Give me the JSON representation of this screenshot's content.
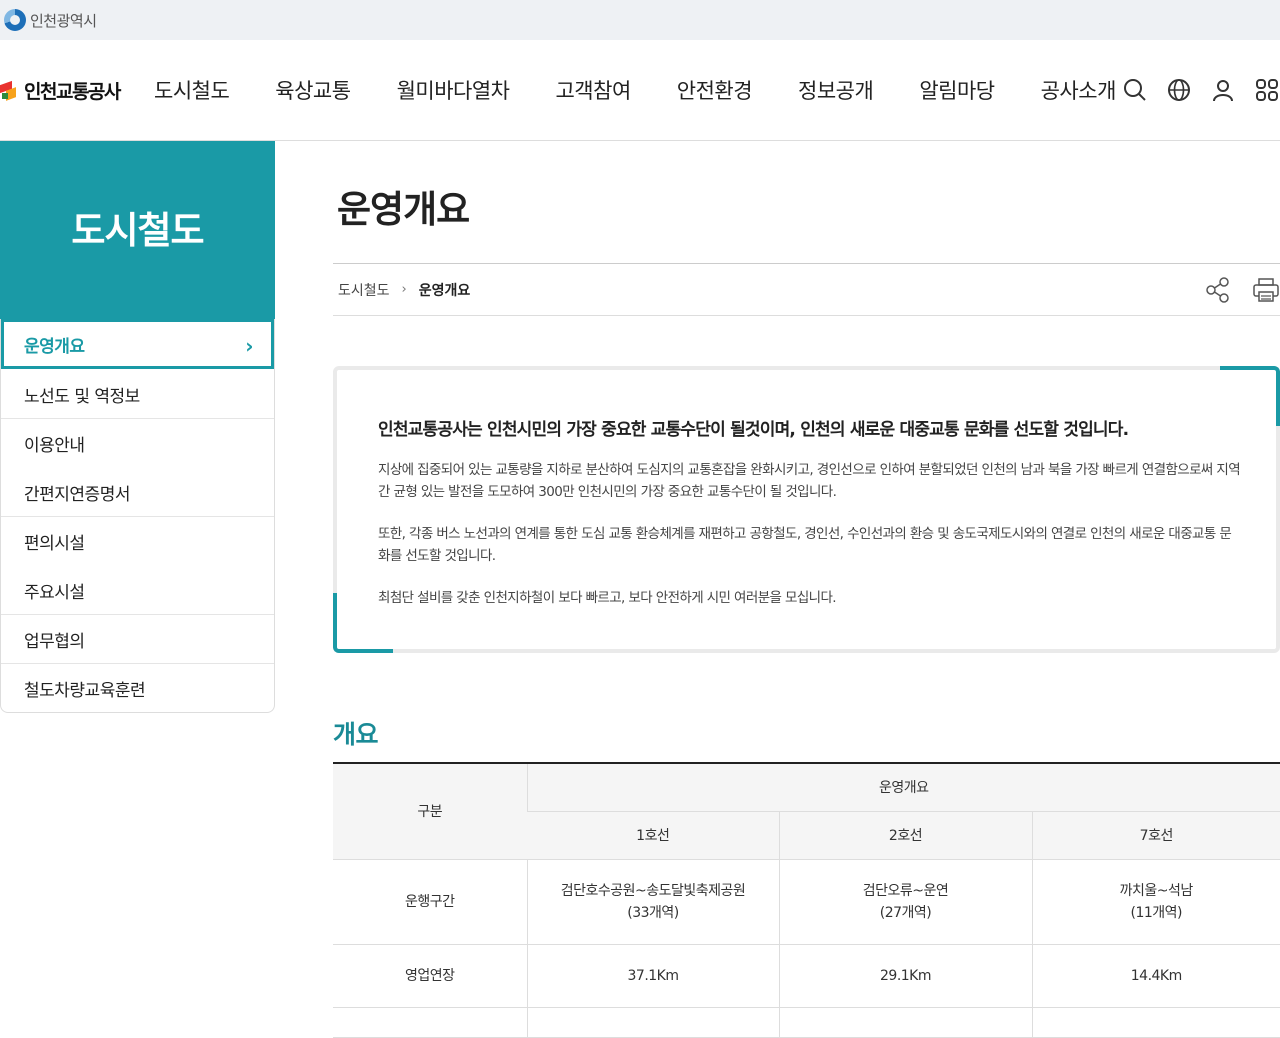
{
  "topbar": {
    "city_name": "인천광역시"
  },
  "header": {
    "brand": "인천교통공사",
    "menu": [
      "도시철도",
      "육상교통",
      "월미바다열차",
      "고객참여",
      "안전환경",
      "정보공개",
      "알림마당",
      "공사소개"
    ],
    "icons": [
      "search-icon",
      "globe-icon",
      "user-icon",
      "sitemap-icon"
    ]
  },
  "sidebar": {
    "title": "도시철도",
    "items": [
      {
        "label": "운영개요",
        "active": true
      },
      {
        "label": "노선도 및 역정보"
      },
      {
        "label": "이용안내"
      },
      {
        "label": "간편지연증명서"
      },
      {
        "label": "편의시설"
      },
      {
        "label": "주요시설"
      },
      {
        "label": "업무협의"
      },
      {
        "label": "철도차량교육훈련"
      }
    ]
  },
  "main": {
    "page_title": "운영개요",
    "breadcrumb": {
      "parent": "도시철도",
      "current": "운영개요"
    },
    "intro": {
      "heading": "인천교통공사는 인천시민의 가장 중요한 교통수단이 될것이며, 인천의 새로운 대중교통 문화를 선도할 것입니다.",
      "p1": "지상에 집중되어 있는 교통량을 지하로 분산하여 도심지의 교통혼잡을 완화시키고, 경인선으로 인하여 분할되었던 인천의 남과 북을 가장 빠르게 연결함으로써 지역 간 균형 있는 발전을 도모하여 300만 인천시민의 가장 중요한 교통수단이 될 것입니다.",
      "p2": "또한, 각종 버스 노선과의 연계를 통한 도심 교통 환승체계를 재편하고 공항철도, 경인선, 수인선과의 환승 및 송도국제도시와의 연결로 인천의 새로운 대중교통 문화를 선도할 것입니다.",
      "p3": "최첨단 설비를 갖춘 인천지하철이 보다 빠르고, 보다 안전하게 시민 여러분을 모십니다."
    },
    "section_title": "개요",
    "table": {
      "col_category": "구분",
      "group_header": "운영개요",
      "lines": [
        "1호선",
        "2호선",
        "7호선"
      ],
      "rows": [
        {
          "label": "운행구간",
          "cells": [
            [
              "검단호수공원~송도달빛축제공원",
              "(33개역)"
            ],
            [
              "검단오류~운연",
              "(27개역)"
            ],
            [
              "까치울~석남",
              "(11개역)"
            ]
          ]
        },
        {
          "label": "영업연장",
          "cells": [
            [
              "37.1Km"
            ],
            [
              "29.1Km"
            ],
            [
              "14.4Km"
            ]
          ]
        }
      ]
    }
  },
  "colors": {
    "accent": "#1a9aa6",
    "section_title": "#1a8a96"
  }
}
